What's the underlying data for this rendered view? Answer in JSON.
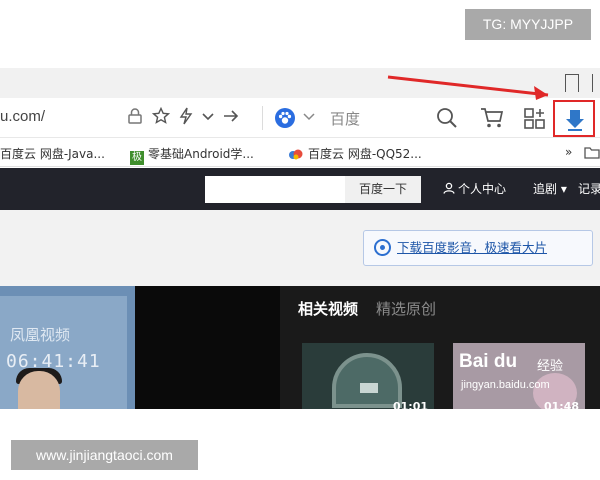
{
  "watermarks": {
    "top": "TG: MYYJJPP",
    "bottom": "www.jinjiangtaoci.com"
  },
  "browser": {
    "url": "u.com/",
    "search_engine": "百度",
    "icons": [
      "lock-icon",
      "star-icon",
      "lightning-icon",
      "chevron-down-icon",
      "forward-arrow-icon",
      "paw-icon",
      "search-icon",
      "cart-icon",
      "extensions-icon",
      "download-icon"
    ],
    "bookmarks": [
      {
        "label": "百度云 网盘-Java..."
      },
      {
        "label": "零基础Android学...",
        "badge": "极"
      },
      {
        "label": "百度云 网盘-QQ52..."
      },
      {
        "label": "»"
      }
    ],
    "highlight_color": "#e02828"
  },
  "site": {
    "search_button": "百度一下",
    "links": [
      "个人中心",
      "追剧",
      "记录"
    ],
    "promo": "下载百度影音，极速看大片",
    "related_tabs": {
      "active": "相关视频",
      "inactive": "精选原创"
    },
    "player": {
      "logo": "凤凰视频",
      "time": "06:41:41"
    },
    "thumbs": [
      {
        "duration": "01:01"
      },
      {
        "duration": "01:48",
        "brand": "Bai du",
        "brand_sub": "经验",
        "url": "jingyan.baidu.com"
      }
    ]
  }
}
